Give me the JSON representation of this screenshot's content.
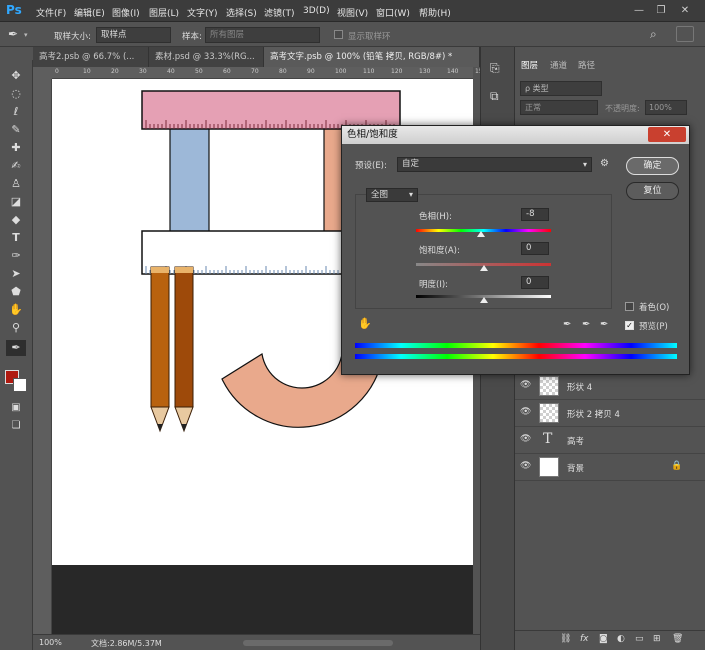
{
  "app": {
    "logo": "Ps"
  },
  "menu": [
    "文件(F)",
    "编辑(E)",
    "图像(I)",
    "图层(L)",
    "文字(Y)",
    "选择(S)",
    "滤镜(T)",
    "3D(D)",
    "视图(V)",
    "窗口(W)",
    "帮助(H)"
  ],
  "window_controls": {
    "minimize": "—",
    "maximize": "❐",
    "close": "✕"
  },
  "options_bar": {
    "sample_size_label": "取样大小:",
    "sample_size_value": "取样点",
    "sample_label": "样本:",
    "sample_value": "所有图层",
    "show_ring_label": "显示取样环"
  },
  "doc_tabs": [
    "高考2.psb @ 66.7% (...",
    "素材.psd @ 33.3%(RG...",
    "高考文字.psb @ 100% (铅笔 拷贝, RGB/8#) *"
  ],
  "ruler_h_ticks": [
    "0",
    "10",
    "20",
    "30",
    "40",
    "50",
    "60",
    "70",
    "80",
    "90",
    "100",
    "110",
    "120",
    "130",
    "140",
    "150",
    "160",
    "170",
    "180",
    "190",
    "200"
  ],
  "status": {
    "zoom": "100%",
    "doc": "文档:2.86M/5.37M"
  },
  "layers_panel": {
    "tabs": [
      "图层",
      "通道",
      "路径"
    ],
    "filter_label": "ρ 类型",
    "blend_mode": "正常",
    "opacity_label": "不透明度:",
    "opacity_value": "100%",
    "layers": [
      {
        "name": "形状 4",
        "thumb": "checker"
      },
      {
        "name": "形状 2 拷贝 4",
        "thumb": "checker"
      },
      {
        "name": "高考",
        "thumb": "text"
      },
      {
        "name": "背景",
        "thumb": "white",
        "locked": true
      }
    ],
    "bottom_icons": [
      "link-icon",
      "fx-icon",
      "mask-icon",
      "adjustment-icon",
      "folder-icon",
      "new-layer-icon",
      "trash-icon"
    ]
  },
  "dialog": {
    "title": "色相/饱和度",
    "close": "✕",
    "preset_label": "预设(E):",
    "preset_value": "自定",
    "channel_value": "全图",
    "hue_label": "色相(H):",
    "hue_value": "-8",
    "saturation_label": "饱和度(A):",
    "saturation_value": "0",
    "lightness_label": "明度(I):",
    "lightness_value": "0",
    "ok_label": "确定",
    "reset_label": "复位",
    "colorize_label": "着色(O)",
    "colorize_checked": false,
    "preview_label": "预览(P)",
    "preview_checked": true,
    "hue_position": 0.478,
    "saturation_position": 0.5,
    "lightness_position": 0.5
  },
  "colors": {
    "accent_close": "#c9402f",
    "ruler_pink": "#e5a0b4",
    "blue_rect": "#9db8d8",
    "peach": "#e9a98c",
    "pencil": "#b8620f"
  }
}
